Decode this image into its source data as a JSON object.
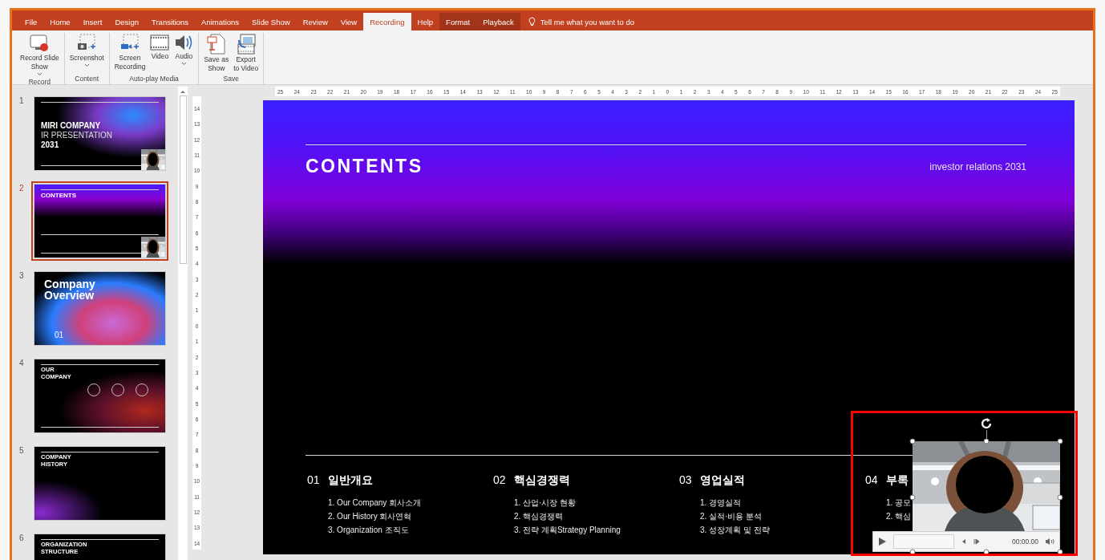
{
  "tabs": [
    {
      "label": "File",
      "selected": false,
      "kind": "normal"
    },
    {
      "label": "Home",
      "selected": false,
      "kind": "normal"
    },
    {
      "label": "Insert",
      "selected": false,
      "kind": "normal"
    },
    {
      "label": "Design",
      "selected": false,
      "kind": "normal"
    },
    {
      "label": "Transitions",
      "selected": false,
      "kind": "normal"
    },
    {
      "label": "Animations",
      "selected": false,
      "kind": "normal"
    },
    {
      "label": "Slide Show",
      "selected": false,
      "kind": "normal"
    },
    {
      "label": "Review",
      "selected": false,
      "kind": "normal"
    },
    {
      "label": "View",
      "selected": false,
      "kind": "normal"
    },
    {
      "label": "Recording",
      "selected": true,
      "kind": "normal"
    },
    {
      "label": "Help",
      "selected": false,
      "kind": "normal"
    },
    {
      "label": "Format",
      "selected": false,
      "kind": "contextual"
    },
    {
      "label": "Playback",
      "selected": false,
      "kind": "contextual"
    }
  ],
  "tell_me": "Tell me what you want to do",
  "ribbon_groups": [
    {
      "label": "Record",
      "buttons": [
        {
          "lines": [
            "Record Slide",
            "Show"
          ],
          "kind": "record",
          "dropdown": true
        }
      ]
    },
    {
      "label": "Content",
      "buttons": [
        {
          "lines": [
            "Screenshot"
          ],
          "kind": "screenshot",
          "dropdown": true
        }
      ]
    },
    {
      "label": "Auto-play Media",
      "buttons": [
        {
          "lines": [
            "Screen",
            "Recording"
          ],
          "kind": "screen-recording",
          "dropdown": false
        },
        {
          "lines": [
            "Video"
          ],
          "kind": "video",
          "dropdown": false
        },
        {
          "lines": [
            "Audio"
          ],
          "kind": "audio",
          "dropdown": true
        }
      ]
    },
    {
      "label": "Save",
      "buttons": [
        {
          "lines": [
            "Save as",
            "Show"
          ],
          "kind": "save-show",
          "dropdown": false
        },
        {
          "lines": [
            "Export",
            "to Video"
          ],
          "kind": "export",
          "dropdown": false
        }
      ]
    }
  ],
  "thumbnails": [
    {
      "number": "1",
      "selected": false,
      "kind": "title",
      "title_lines": [
        "MIRI COMPANY",
        "IR PRESENTATION",
        "2031"
      ],
      "has_video": true
    },
    {
      "number": "2",
      "selected": true,
      "kind": "contents",
      "title_lines": [
        "CONTENTS"
      ],
      "has_video": true
    },
    {
      "number": "3",
      "selected": false,
      "kind": "section",
      "title_lines": [
        "Company",
        "Overview"
      ],
      "section_number": "01",
      "has_video": false
    },
    {
      "number": "4",
      "selected": false,
      "kind": "about",
      "title_lines": [
        "OUR",
        "COMPANY"
      ],
      "has_video": false
    },
    {
      "number": "5",
      "selected": false,
      "kind": "history",
      "title_lines": [
        "COMPANY",
        "HISTORY"
      ],
      "has_video": false
    },
    {
      "number": "6",
      "selected": false,
      "kind": "org",
      "title_lines": [
        "ORGANIZATION",
        "STRUCTURE"
      ],
      "has_video": false
    }
  ],
  "ruler_horizontal": [
    "25",
    "24",
    "23",
    "22",
    "21",
    "20",
    "19",
    "18",
    "17",
    "16",
    "15",
    "14",
    "13",
    "12",
    "11",
    "10",
    "9",
    "8",
    "7",
    "6",
    "5",
    "4",
    "3",
    "2",
    "1",
    "0",
    "1",
    "2",
    "3",
    "4",
    "5",
    "6",
    "7",
    "8",
    "9",
    "10",
    "11",
    "12",
    "13",
    "14",
    "15",
    "16",
    "17",
    "18",
    "19",
    "20",
    "21",
    "22",
    "23",
    "24",
    "25"
  ],
  "ruler_vertical": [
    "14",
    "13",
    "12",
    "11",
    "10",
    "9",
    "8",
    "7",
    "6",
    "5",
    "4",
    "3",
    "2",
    "1",
    "0",
    "1",
    "2",
    "3",
    "4",
    "5",
    "6",
    "7",
    "8",
    "9",
    "10",
    "11",
    "12",
    "13",
    "14"
  ],
  "slide": {
    "title": "CONTENTS",
    "subtitle": "investor relations 2031",
    "sections": [
      {
        "number": "01",
        "title": "일반개요",
        "items": [
          "1. Our Company 회사소개",
          "2. Our History 회사연혁",
          "3. Organization 조직도"
        ]
      },
      {
        "number": "02",
        "title": "핵심경쟁력",
        "items": [
          "1. 산업·시장 현황",
          "2. 핵심경쟁력",
          "3. 전략 계획Strategy Planning"
        ]
      },
      {
        "number": "03",
        "title": "영업실적",
        "items": [
          "1. 경영실적",
          "2. 실적·비용 분석",
          "3. 성장계획 및 전략"
        ]
      },
      {
        "number": "04",
        "title": "부록",
        "items": [
          "1. 공모",
          "2. 핵심"
        ]
      }
    ],
    "video": {
      "kind": "picture",
      "time": "00:00.00"
    }
  }
}
